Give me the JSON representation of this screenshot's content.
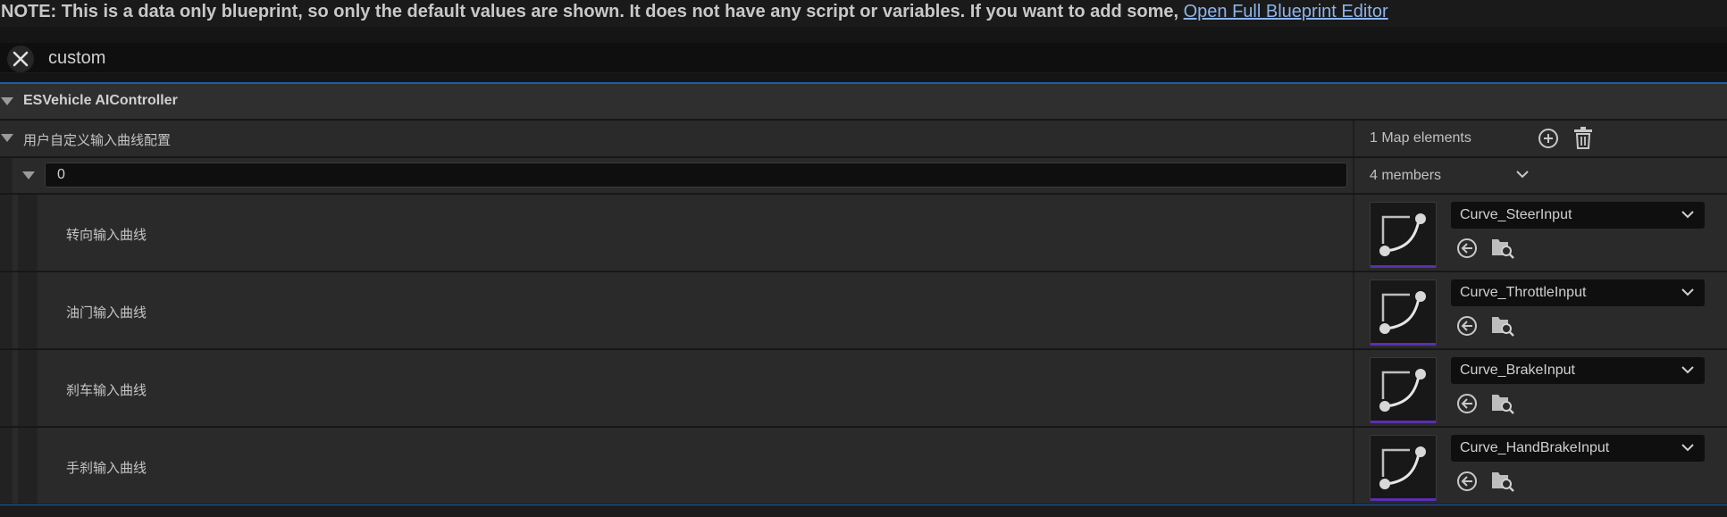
{
  "note": {
    "text": "NOTE: This is a data only blueprint, so only the default values are shown.  It does not have any script or variables.  If you want to add some, ",
    "link": "Open Full Blueprint Editor"
  },
  "search": {
    "value": "custom"
  },
  "category": {
    "title": "ESVehicle AIController"
  },
  "map_property": {
    "label": "用户自定义输入曲线配置",
    "elements_text": "1 Map elements"
  },
  "element": {
    "key_value": "0",
    "members_text": "4 members"
  },
  "members": [
    {
      "label": "转向输入曲线",
      "asset": "Curve_SteerInput"
    },
    {
      "label": "油门输入曲线",
      "asset": "Curve_ThrottleInput"
    },
    {
      "label": "刹车输入曲线",
      "asset": "Curve_BrakeInput"
    },
    {
      "label": "手刹输入曲线",
      "asset": "Curve_HandBrakeInput"
    }
  ],
  "icons": {
    "clear": "close-icon",
    "add": "plus-circle-icon",
    "delete": "trash-icon",
    "expand": "chevron-down-icon",
    "use_selected": "arrow-left-circle-icon",
    "browse": "folder-search-icon",
    "thumbnail": "curve-asset-icon"
  },
  "colors": {
    "accent_blue": "#1f5ca8",
    "link": "#8db4ea",
    "thumbnail_underline": "#5b2fb0"
  }
}
